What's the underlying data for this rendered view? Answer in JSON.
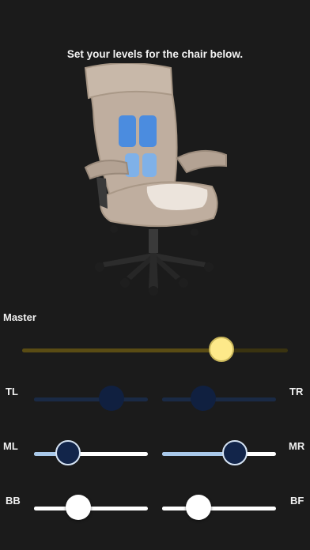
{
  "header": {
    "title": "Set your levels for the chair below."
  },
  "colors": {
    "background": "#1b1b1b",
    "master_thumb": "#fde98a",
    "mid_thumb": "#12254a",
    "mid_fill": "#a9c9ea",
    "dim_thumb": "#102040",
    "chair_fabric": "#bfae9f",
    "zone_active": "#4b8cdf",
    "zone_inactive": "#7fb1e8"
  },
  "master": {
    "label": "Master",
    "value": 0.75
  },
  "sliders": {
    "tl": {
      "label": "TL",
      "value": 0.68
    },
    "tr": {
      "label": "TR",
      "value": 0.36
    },
    "ml": {
      "label": "ML",
      "value": 0.3
    },
    "mr": {
      "label": "MR",
      "value": 0.64
    },
    "bb": {
      "label": "BB",
      "value": 0.39
    },
    "bf": {
      "label": "BF",
      "value": 0.32
    }
  }
}
